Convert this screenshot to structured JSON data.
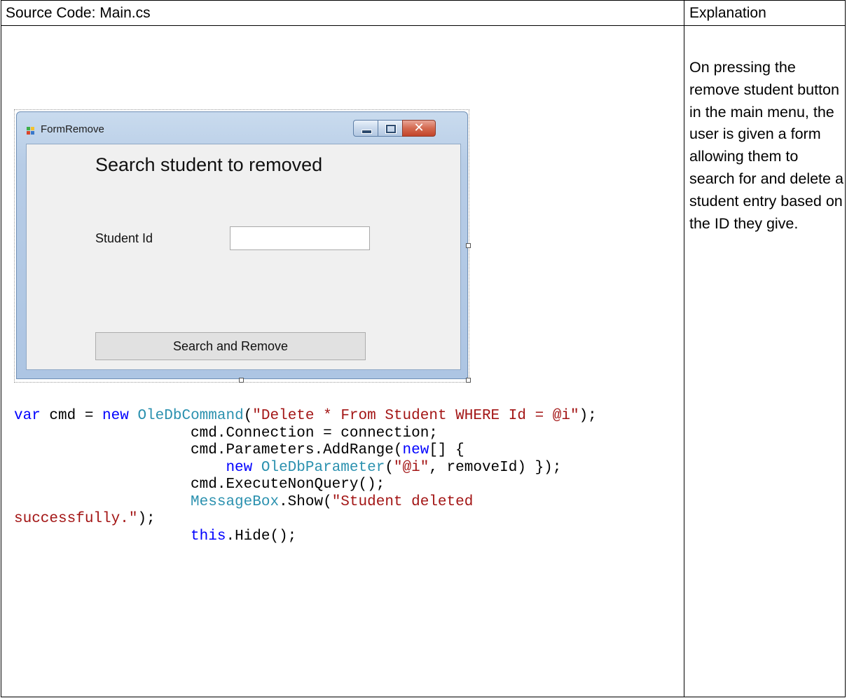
{
  "table": {
    "header_left": "Source Code: Main.cs",
    "header_right": "Explanation"
  },
  "explanation": "On pressing the remove student button in the main menu, the user is given a form allowing them to search for and delete a student entry based on the ID they give.",
  "form": {
    "window_title": "FormRemove",
    "heading": "Search student to removed",
    "label": "Student Id",
    "input_value": "",
    "button_label": "Search and Remove",
    "caption_buttons": [
      "minimize-icon",
      "maximize-icon",
      "close-icon"
    ],
    "close_glyph": "✕"
  },
  "code": {
    "line1": {
      "kw1": "var",
      "t1": " cmd = ",
      "kw2": "new",
      "t2": " ",
      "ty1": "OleDbCommand",
      "t3": "(",
      "st1": "\"Delete * From Student WHERE Id = @i\"",
      "t4": ");"
    },
    "line2": "                    cmd.Connection = connection;",
    "line3": {
      "t1": "                    cmd.Parameters.AddRange(",
      "kw1": "new",
      "t2": "[] {"
    },
    "line4": {
      "t1": "                        ",
      "kw1": "new",
      "t2": " ",
      "ty1": "OleDbParameter",
      "t3": "(",
      "st1": "\"@i\"",
      "t4": ", removeId) });"
    },
    "line5": "                    cmd.ExecuteNonQuery();",
    "line6": {
      "t1": "                    ",
      "ty1": "MessageBox",
      "t2": ".Show(",
      "st1": "\"Student deleted"
    },
    "line7": {
      "st1": "successfully.\"",
      "t1": ");"
    },
    "line8": {
      "t1": "                    ",
      "kw1": "this",
      "t2": ".Hide();"
    }
  },
  "colors": {
    "keyword": "#0000ff",
    "type": "#2b91af",
    "string": "#a31515"
  }
}
